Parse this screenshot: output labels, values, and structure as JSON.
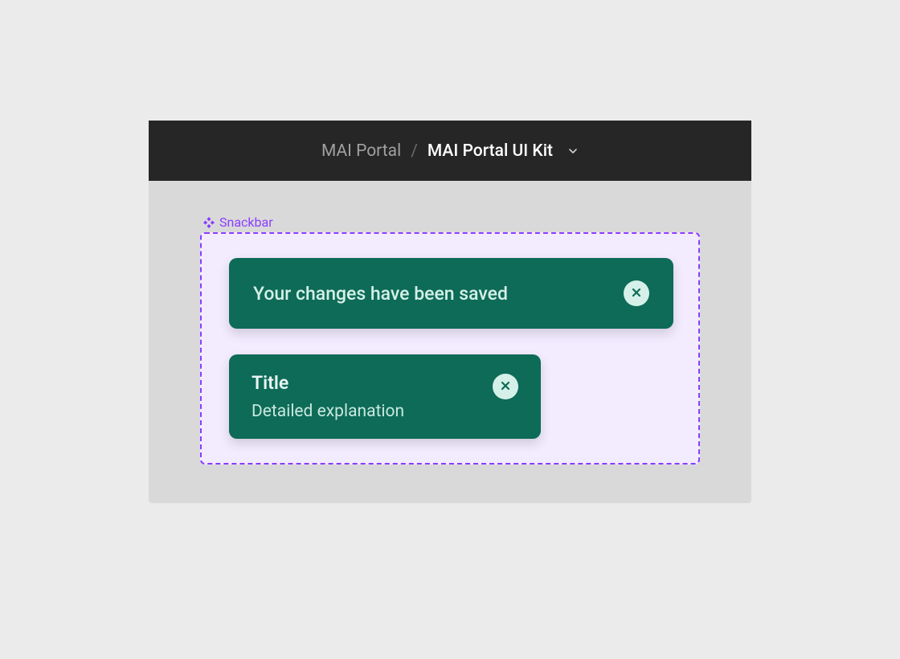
{
  "header": {
    "breadcrumb_parent": "MAI Portal",
    "breadcrumb_separator": "/",
    "breadcrumb_current": "MAI Portal UI Kit"
  },
  "frame": {
    "label": "Snackbar"
  },
  "snackbars": {
    "simple": {
      "message": "Your changes have been saved"
    },
    "detailed": {
      "title": "Title",
      "detail": "Detailed explanation"
    }
  },
  "colors": {
    "accent_purple": "#8b3dff",
    "snackbar_bg": "#0d6b57",
    "close_bg": "#d5f0e8"
  }
}
